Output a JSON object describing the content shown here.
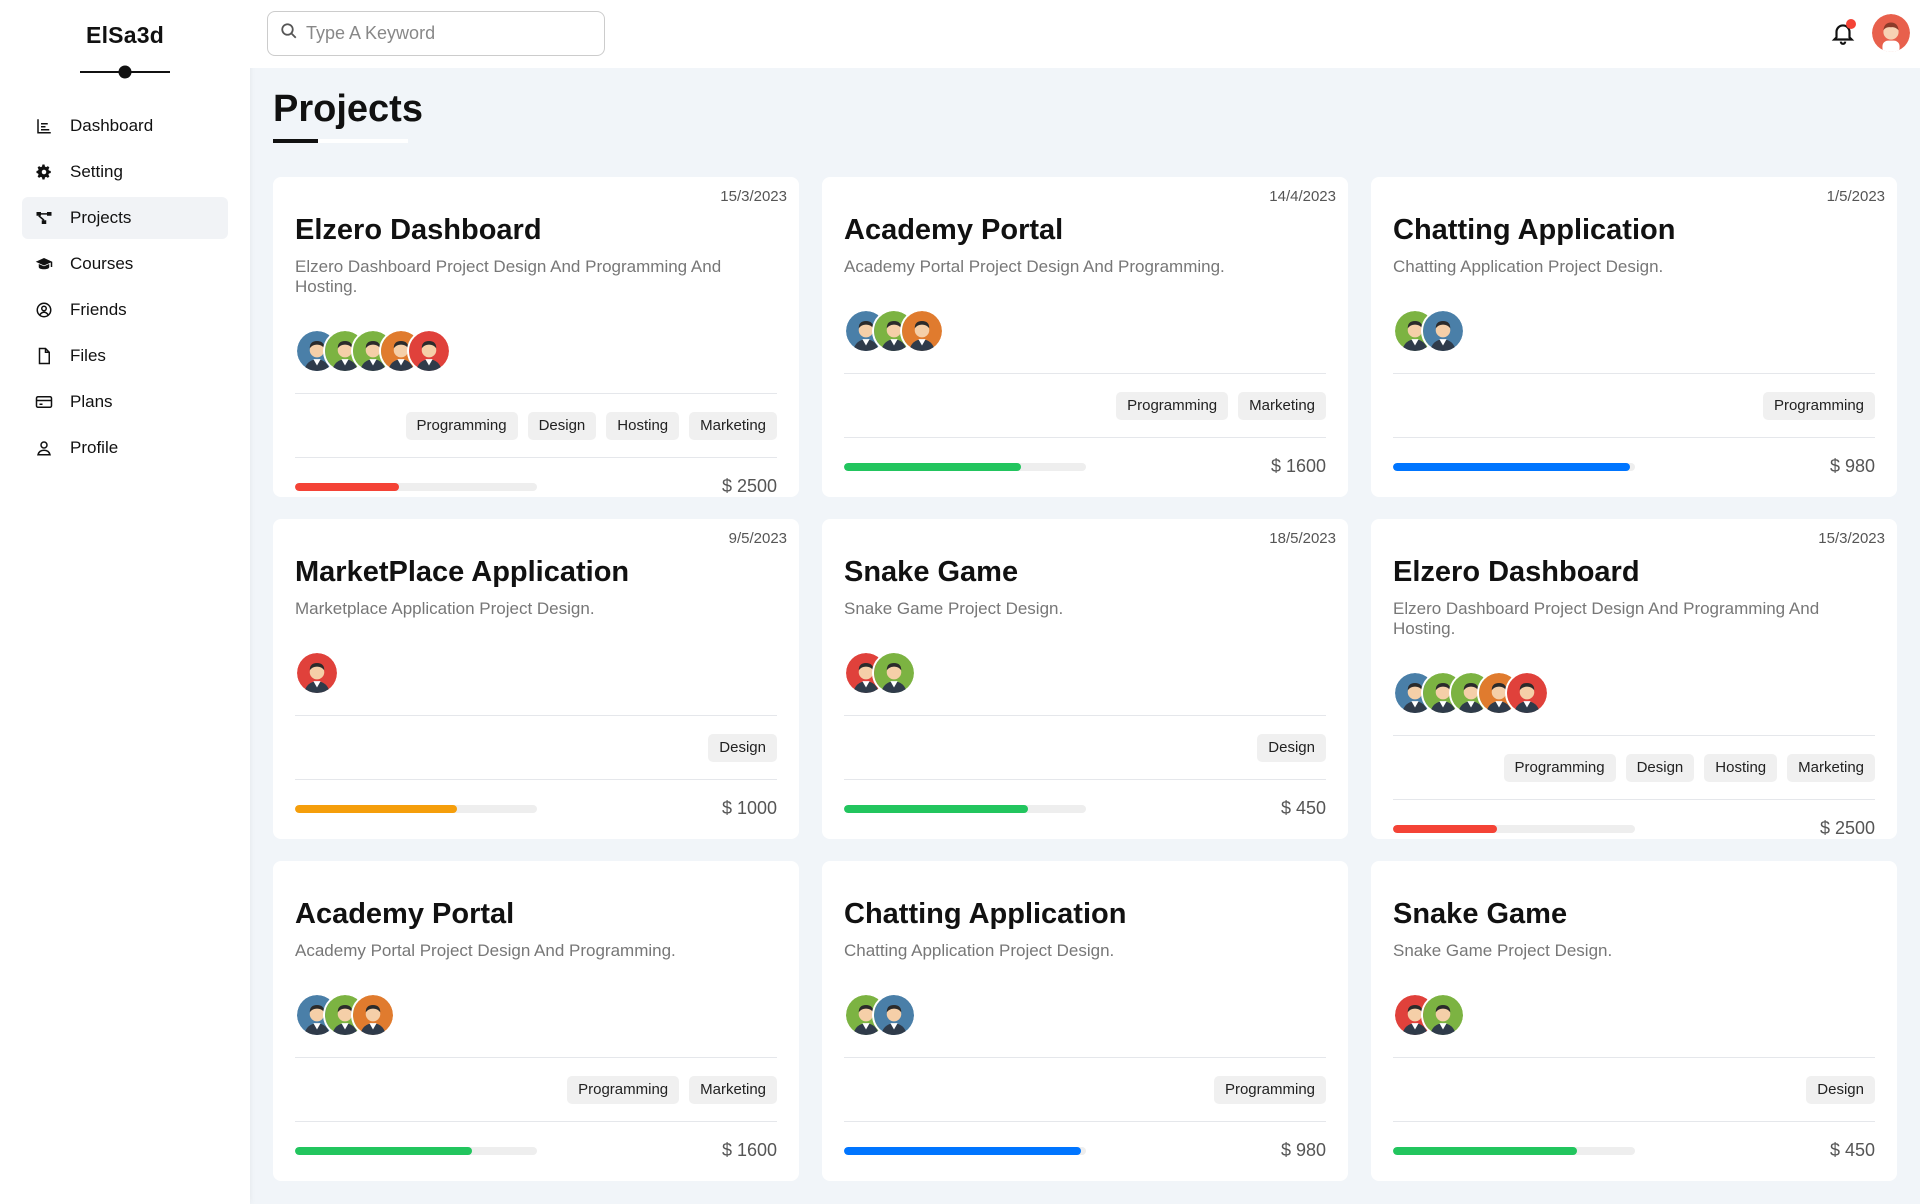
{
  "brand": {
    "name": "ElSa3d"
  },
  "nav": [
    {
      "label": "Dashboard",
      "icon": "chart-icon",
      "active": false
    },
    {
      "label": "Setting",
      "icon": "gear-icon",
      "active": false
    },
    {
      "label": "Projects",
      "icon": "diagram-icon",
      "active": true
    },
    {
      "label": "Courses",
      "icon": "graduation-cap-icon",
      "active": false
    },
    {
      "label": "Friends",
      "icon": "user-circle-icon",
      "active": false
    },
    {
      "label": "Files",
      "icon": "file-icon",
      "active": false
    },
    {
      "label": "Plans",
      "icon": "credit-card-icon",
      "active": false
    },
    {
      "label": "Profile",
      "icon": "user-icon",
      "active": false
    }
  ],
  "search": {
    "placeholder": "Type A Keyword",
    "value": ""
  },
  "header": {
    "notification_dot": true
  },
  "page": {
    "title": "Projects"
  },
  "colors": {
    "red": "#f44336",
    "green": "#22c55e",
    "blue": "#0075ff",
    "orange": "#f59e0b"
  },
  "projects": [
    {
      "date": "15/3/2023",
      "title": "Elzero Dashboard",
      "desc": "Elzero Dashboard Project Design And Programming And Hosting.",
      "team": [
        "blue",
        "green",
        "green",
        "orange",
        "red"
      ],
      "tags": [
        "Programming",
        "Design",
        "Hosting",
        "Marketing"
      ],
      "progress": 0.43,
      "color": "#f44336",
      "price": "$ 2500"
    },
    {
      "date": "14/4/2023",
      "title": "Academy Portal",
      "desc": "Academy Portal Project Design And Programming.",
      "team": [
        "blue",
        "green",
        "orange"
      ],
      "tags": [
        "Programming",
        "Marketing"
      ],
      "progress": 0.73,
      "color": "#22c55e",
      "price": "$ 1600"
    },
    {
      "date": "1/5/2023",
      "title": "Chatting Application",
      "desc": "Chatting Application Project Design.",
      "team": [
        "green",
        "blue"
      ],
      "tags": [
        "Programming"
      ],
      "progress": 0.98,
      "color": "#0075ff",
      "price": "$ 980"
    },
    {
      "date": "9/5/2023",
      "title": "MarketPlace Application",
      "desc": "Marketplace Application Project Design.",
      "team": [
        "red"
      ],
      "tags": [
        "Design"
      ],
      "progress": 0.67,
      "color": "#f59e0b",
      "price": "$ 1000"
    },
    {
      "date": "18/5/2023",
      "title": "Snake Game",
      "desc": "Snake Game Project Design.",
      "team": [
        "red",
        "green"
      ],
      "tags": [
        "Design"
      ],
      "progress": 0.76,
      "color": "#22c55e",
      "price": "$ 450"
    },
    {
      "date": "15/3/2023",
      "title": "Elzero Dashboard",
      "desc": "Elzero Dashboard Project Design And Programming And Hosting.",
      "team": [
        "blue",
        "green",
        "green",
        "orange",
        "red"
      ],
      "tags": [
        "Programming",
        "Design",
        "Hosting",
        "Marketing"
      ],
      "progress": 0.43,
      "color": "#f44336",
      "price": "$ 2500"
    },
    {
      "date": "",
      "title": "Academy Portal",
      "desc": "Academy Portal Project Design And Programming.",
      "team": [
        "blue",
        "green",
        "orange"
      ],
      "tags": [
        "Programming",
        "Marketing"
      ],
      "progress": 0.73,
      "color": "#22c55e",
      "price": "$ 1600"
    },
    {
      "date": "",
      "title": "Chatting Application",
      "desc": "Chatting Application Project Design.",
      "team": [
        "green",
        "blue"
      ],
      "tags": [
        "Programming"
      ],
      "progress": 0.98,
      "color": "#0075ff",
      "price": "$ 980"
    },
    {
      "date": "",
      "title": "Snake Game",
      "desc": "Snake Game Project Design.",
      "team": [
        "red",
        "green"
      ],
      "tags": [
        "Design"
      ],
      "progress": 0.76,
      "color": "#22c55e",
      "price": "$ 450"
    }
  ]
}
